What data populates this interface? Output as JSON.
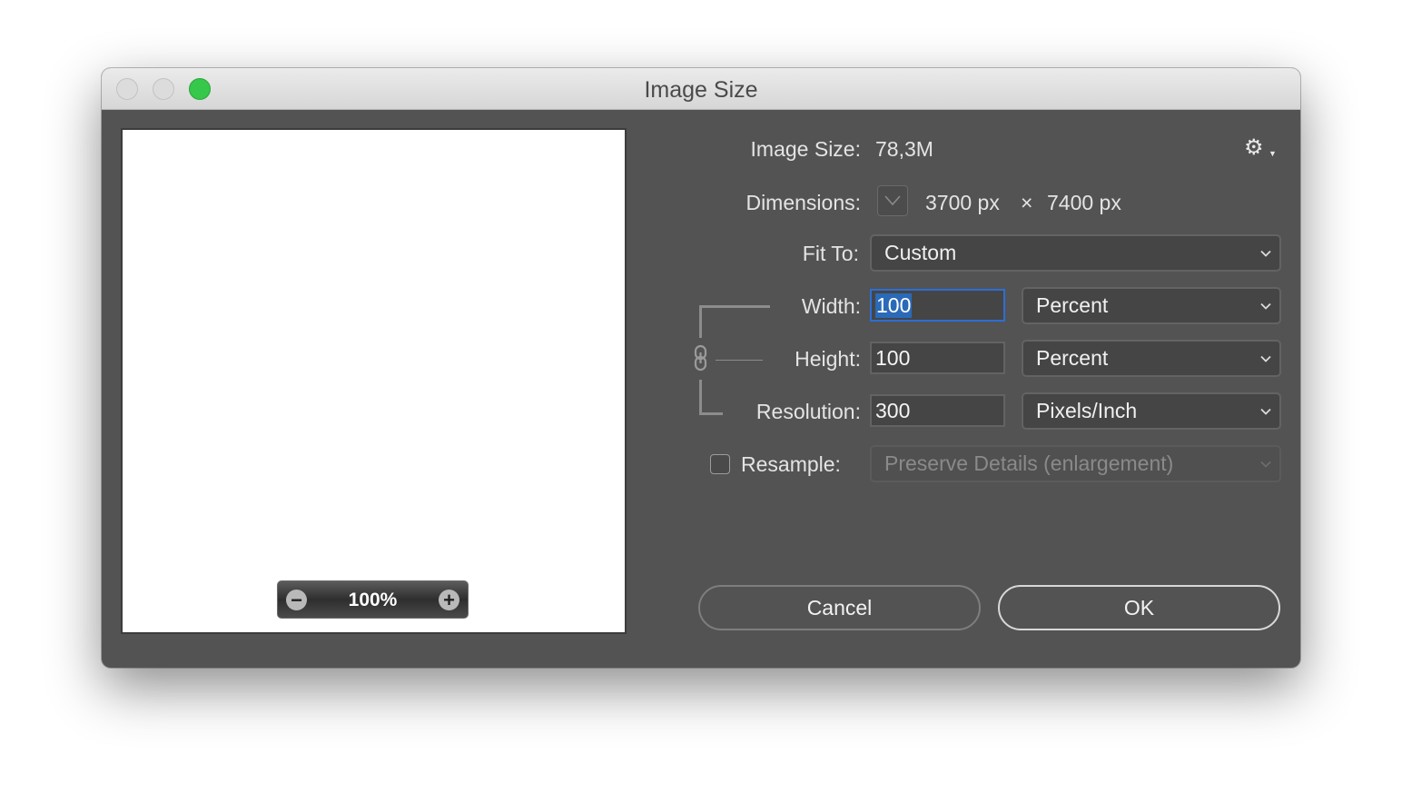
{
  "window": {
    "title": "Image Size",
    "traffic_lights": [
      "close",
      "minimize",
      "zoom"
    ]
  },
  "preview": {
    "zoom_level": "100%",
    "zoom_out_icon": "minus-circle-icon",
    "zoom_in_icon": "plus-circle-icon"
  },
  "info": {
    "image_size_label": "Image Size:",
    "image_size_value": "78,3M",
    "dimensions_label": "Dimensions:",
    "width_px": "3700 px",
    "times": "×",
    "height_px": "7400 px",
    "settings_icon": "gear-icon"
  },
  "fit_to": {
    "label": "Fit To:",
    "value": "Custom"
  },
  "width": {
    "label": "Width:",
    "value": "100",
    "unit": "Percent"
  },
  "height": {
    "label": "Height:",
    "value": "100",
    "unit": "Percent"
  },
  "resolution": {
    "label": "Resolution:",
    "value": "300",
    "unit": "Pixels/Inch"
  },
  "resample": {
    "label": "Resample:",
    "checked": false,
    "method": "Preserve Details (enlargement)"
  },
  "buttons": {
    "cancel": "Cancel",
    "ok": "OK"
  },
  "colors": {
    "accent_focus": "#2c6ed6",
    "zoom_green": "#35c84a",
    "dialog_bg": "#535353"
  }
}
